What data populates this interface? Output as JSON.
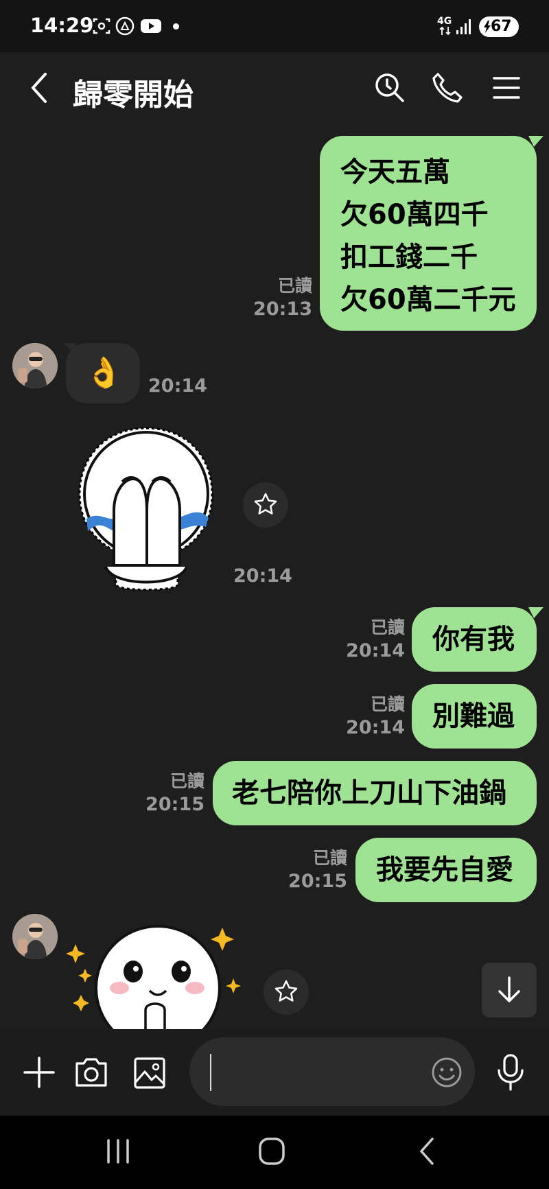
{
  "status_bar": {
    "time": "14:29",
    "network": "4G",
    "battery": "67"
  },
  "header": {
    "title": "歸零開始"
  },
  "messages": {
    "m1": {
      "lines": [
        "今天五萬",
        "欠60萬四千",
        "扣工錢二千",
        "欠60萬二千元"
      ],
      "read": "已讀",
      "time": "20:13"
    },
    "m2": {
      "emoji": "👌",
      "time": "20:14"
    },
    "m3": {
      "time": "20:14"
    },
    "m4": {
      "text": "你有我",
      "read": "已讀",
      "time": "20:14"
    },
    "m5": {
      "text": "別難過",
      "read": "已讀",
      "time": "20:14"
    },
    "m6": {
      "text": "老七陪你上刀山下油鍋",
      "read": "已讀",
      "time": "20:15"
    },
    "m7": {
      "text": "我要先自愛",
      "read": "已讀",
      "time": "20:15"
    }
  },
  "input": {
    "placeholder": ""
  },
  "colors": {
    "bubble_out": "#9fe294",
    "background": "#1e1e1e",
    "meta_text": "#9b9b9b"
  }
}
